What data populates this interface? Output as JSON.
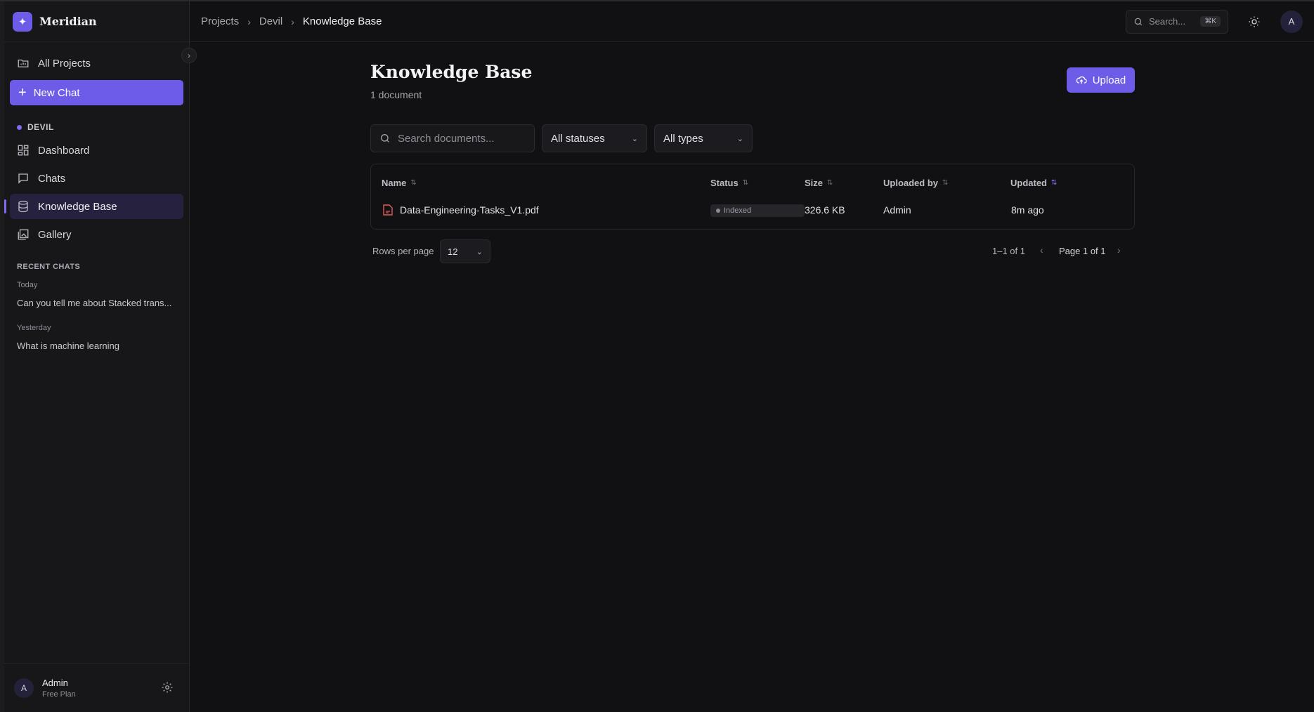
{
  "brand": {
    "name": "Meridian"
  },
  "sidebar": {
    "all_projects": "All Projects",
    "new_chat": "New Chat",
    "project_label": "DEVIL",
    "items": [
      {
        "label": "Dashboard",
        "icon": "dashboard-icon"
      },
      {
        "label": "Chats",
        "icon": "chat-icon"
      },
      {
        "label": "Knowledge Base",
        "icon": "database-icon",
        "active": true
      },
      {
        "label": "Gallery",
        "icon": "gallery-icon"
      }
    ],
    "recent_title": "RECENT CHATS",
    "groups": [
      {
        "label": "Today",
        "items": [
          "Can you tell me about Stacked trans..."
        ]
      },
      {
        "label": "Yesterday",
        "items": [
          "What is machine learning"
        ]
      }
    ],
    "user": {
      "avatar": "A",
      "name": "Admin",
      "plan": "Free Plan"
    }
  },
  "topbar": {
    "breadcrumbs": [
      "Projects",
      "Devil",
      "Knowledge Base"
    ],
    "search_placeholder": "Search...",
    "shortcut": "⌘K",
    "avatar": "A"
  },
  "page": {
    "title": "Knowledge Base",
    "count": "1 document",
    "upload_label": "Upload",
    "search_placeholder": "Search documents...",
    "status_filter": "All statuses",
    "type_filter": "All types"
  },
  "table": {
    "columns": [
      "Name",
      "Status",
      "Size",
      "Uploaded by",
      "Updated"
    ],
    "rows": [
      {
        "name": "Data-Engineering-Tasks_V1.pdf",
        "status": "Indexed",
        "size": "326.6 KB",
        "uploaded_by": "Admin",
        "updated": "8m ago"
      }
    ]
  },
  "pager": {
    "rows_label": "Rows per page",
    "rows_value": "12",
    "range": "1–1 of 1",
    "page_text": "Page 1 of 1"
  },
  "colors": {
    "accent": "#6d5ce8",
    "background": "#111113",
    "sidebar": "#17171a"
  }
}
